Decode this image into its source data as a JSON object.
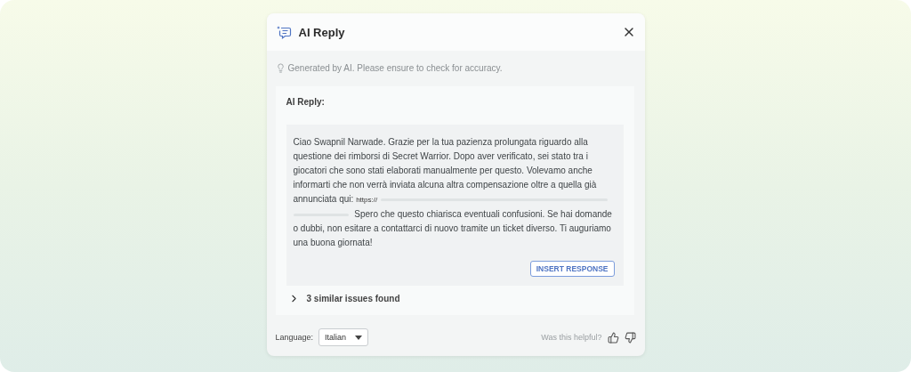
{
  "dialog": {
    "title": "AI Reply",
    "notice": "Generated by AI. Please ensure to check for accuracy.",
    "reply": {
      "heading": "AI Reply:",
      "text_before": "Ciao Swapnil Narwade. Grazie per la tua pazienza prolungata riguardo alla questione dei rimborsi di Secret Warrior. Dopo aver verificato, sei stato tra i giocatori che sono stati elaborati manualmente per questo. Volevamo anche informarti che non verrà inviata alcuna altra compensazione oltre a quella già annunciata qui:",
      "link": "https://",
      "text_after": "Spero che questo chiarisca eventuali confusioni. Se hai domande o dubbi, non esitare a contattarci di nuovo tramite un ticket diverso. Ti auguriamo una buona giornata!",
      "button": "INSERT RESPONSE"
    },
    "similar": {
      "label": "3 similar issues found",
      "expanded": false
    },
    "footer": {
      "language_label": "Language:",
      "language_value": "Italian",
      "feedback_prompt": "Was this helpful?"
    }
  }
}
